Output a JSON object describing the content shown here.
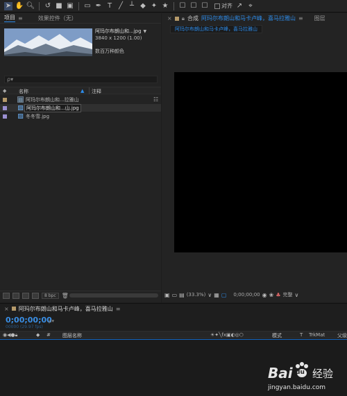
{
  "toolbar": {
    "align_label": "对齐"
  },
  "project_panel": {
    "tab_project": "项目",
    "tab_effects": "效果控件（无）",
    "preview": {
      "filename": "阿玛尔布朗山和...jpg",
      "filename_suffix": "▼",
      "dimensions": "3840 x 1200 (1.00)",
      "colors": "数百万种颜色"
    },
    "search_placeholder": "ρ▾",
    "columns": {
      "name": "名称",
      "comment": "注释"
    },
    "items": [
      {
        "name": "阿玛尔布朗山和...拉雅山",
        "type": "composition",
        "label_color": "#b59a6a"
      },
      {
        "name": "阿玛尔布朗山和...山.jpg",
        "type": "image",
        "label_color": "#9a8fd0"
      },
      {
        "name": "冬冬雪.jpg",
        "type": "image",
        "label_color": "#9a8fd0"
      }
    ],
    "footer": {
      "bpc": "8 bpc"
    }
  },
  "composition_panel": {
    "tab_prefix": "合成",
    "tab_name": "阿玛尔布朗山和马卡卢峰，喜马拉雅山",
    "tab_extra": "图层",
    "sub_tab": "阿玛尔布朗山和马卡卢峰，喜马拉雅山",
    "footer": {
      "zoom": "(33.3%)",
      "timecode": "0;00;00;00",
      "quality": "完整"
    }
  },
  "timeline": {
    "tab_name": "阿玛尔布朗山和马卡卢峰，喜马拉雅山",
    "timecode": "0;00;00;00",
    "fps": "00000 (29.97 fps)",
    "search_placeholder": "ρ▾",
    "columns": {
      "num": "#",
      "layer_name": "图层名称",
      "mode": "模式",
      "t": "T",
      "trkmat": "TrkMat",
      "parent": "父级"
    }
  },
  "watermark": {
    "brand": "Bai",
    "brand2": "du",
    "service": "经验",
    "url": "jingyan.baidu.com"
  },
  "colors": {
    "accent": "#2d8ceb",
    "panel_bg": "#232323",
    "viewer_bg": "#000000"
  }
}
